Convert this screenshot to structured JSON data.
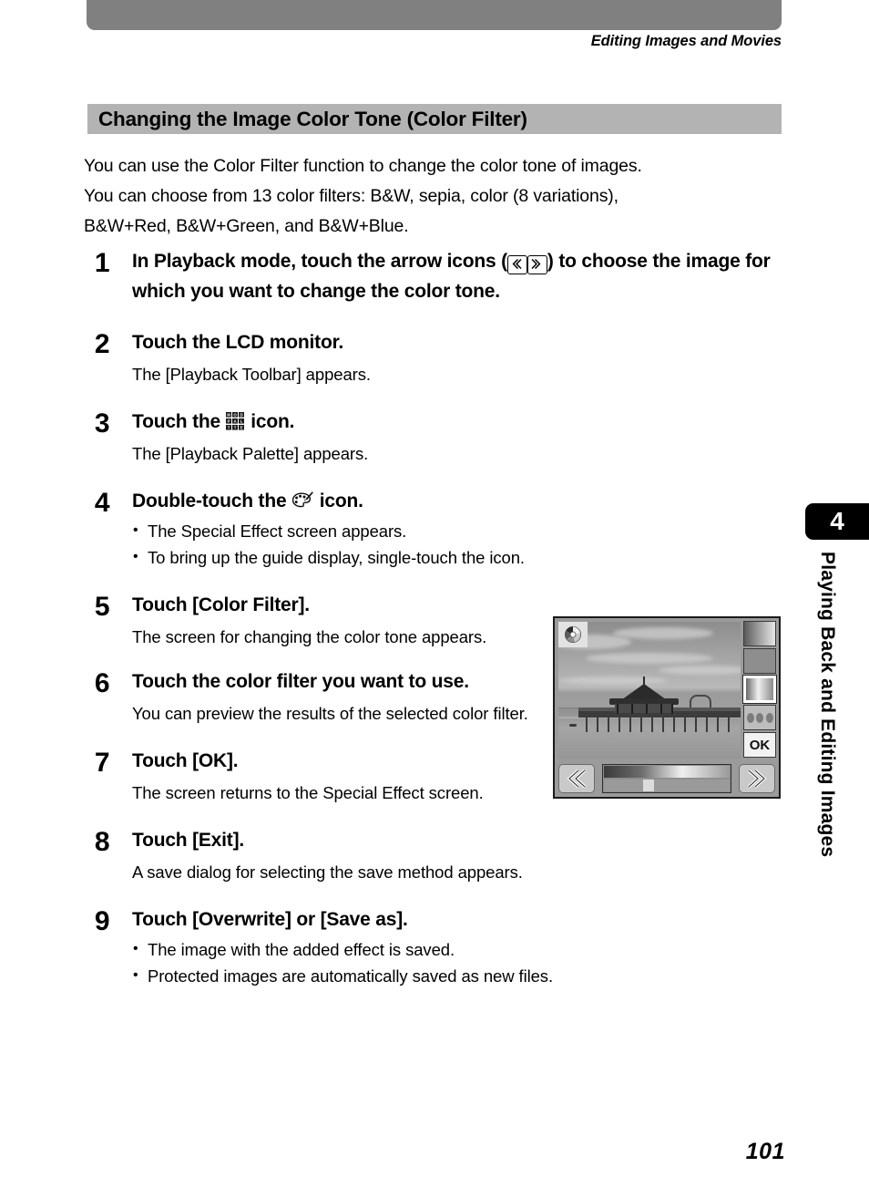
{
  "header": {
    "running_head": "Editing Images and Movies"
  },
  "section": {
    "title": "Changing the Image Color Tone (Color Filter)"
  },
  "intro": {
    "line1": "You can use the Color Filter function to change the color tone of images.",
    "line2": "You can choose from 13 color filters: B&W, sepia, color (8 variations),",
    "line3": "B&W+Red, B&W+Green, and B&W+Blue."
  },
  "steps": [
    {
      "num": "1",
      "head_pre": "In Playback mode, touch the arrow icons (",
      "icon": "arrow-left-right-icons",
      "head_post": ") to choose the image for which you want to change the color tone.",
      "body": "",
      "bullets": []
    },
    {
      "num": "2",
      "head_pre": "Touch the LCD monitor.",
      "icon": "",
      "head_post": "",
      "body": "The [Playback Toolbar] appears.",
      "bullets": []
    },
    {
      "num": "3",
      "head_pre": "Touch the ",
      "icon": "mode-palette-icon",
      "head_post": " icon.",
      "body": "The [Playback Palette] appears.",
      "bullets": []
    },
    {
      "num": "4",
      "head_pre": "Double-touch the ",
      "icon": "artist-palette-icon",
      "head_post": " icon.",
      "body": "",
      "bullets": [
        "The Special Effect screen appears.",
        "To bring up the guide display, single-touch the icon."
      ]
    },
    {
      "num": "5",
      "head_pre": "Touch [Color Filter].",
      "icon": "",
      "head_post": "",
      "body": "The screen for changing the color tone appears.",
      "bullets": []
    },
    {
      "num": "6",
      "head_pre": "Touch the color filter you want to use.",
      "icon": "",
      "head_post": "",
      "body": "You can preview the results of the selected color filter.",
      "bullets": []
    },
    {
      "num": "7",
      "head_pre": "Touch [OK].",
      "icon": "",
      "head_post": "",
      "body": "The screen returns to the Special Effect screen.",
      "bullets": []
    },
    {
      "num": "8",
      "head_pre": "Touch [Exit].",
      "icon": "",
      "head_post": "",
      "body": "A save dialog for selecting the save method appears.",
      "bullets": []
    },
    {
      "num": "9",
      "head_pre": "Touch [Overwrite] or [Save as].",
      "icon": "",
      "head_post": "",
      "body": "",
      "bullets": [
        "The image with the added effect is saved.",
        "Protected images are automatically saved as new files."
      ]
    }
  ],
  "figure": {
    "name": "color-filter-lcd-screen",
    "description": "Camera LCD showing a black and white photo of a pier with a pavilion over water, a vertical toolbar on the right and a color slider with left/right arrows at the bottom",
    "ok_label": "OK",
    "toolbar_buttons": [
      "gradient-button",
      "plain-gray-button",
      "selected-gradient-button",
      "three-dots-button",
      "ok-button"
    ],
    "badge_icon": "color-wheel-icon",
    "nav_left_icon": "double-chevron-left-icon",
    "nav_right_icon": "double-chevron-right-icon"
  },
  "chapter": {
    "number": "4",
    "label": "Playing Back and Editing Images"
  },
  "page": {
    "number": "101"
  },
  "colors": {
    "header_bar": "#808080",
    "section_bar": "#b3b3b3",
    "tab_black": "#000000"
  }
}
